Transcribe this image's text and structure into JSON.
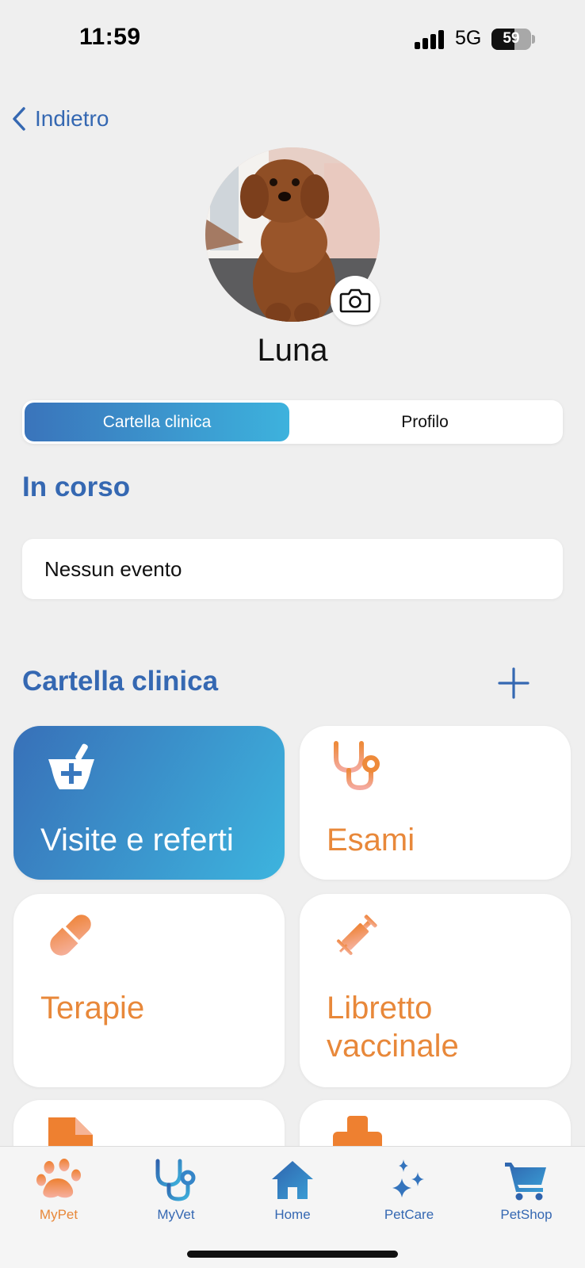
{
  "status_bar": {
    "time": "11:59",
    "network": "5G",
    "battery": "59"
  },
  "nav": {
    "back_label": "Indietro"
  },
  "pet": {
    "name": "Luna",
    "photo": "dog-photo"
  },
  "segmented": {
    "active": "Cartella clinica",
    "other": "Profilo"
  },
  "in_corso": {
    "title": "In corso",
    "empty_text": "Nessun evento"
  },
  "cartella": {
    "title": "Cartella clinica",
    "tiles": [
      {
        "label": "Visite e referti",
        "icon": "mortar-pestle-medical-icon",
        "active": true
      },
      {
        "label": "Esami",
        "icon": "stethoscope-icon",
        "active": false
      },
      {
        "label": "Terapie",
        "icon": "pill-icon",
        "active": false
      },
      {
        "label": "Libretto vaccinale",
        "icon": "syringe-icon",
        "active": false
      },
      {
        "label": "",
        "icon": "document-icon",
        "active": false
      },
      {
        "label": "",
        "icon": "medical-case-icon",
        "active": false
      }
    ]
  },
  "tabbar": {
    "items": [
      {
        "label": "MyPet",
        "icon": "paw-icon",
        "active": true
      },
      {
        "label": "MyVet",
        "icon": "stethoscope-icon",
        "active": false
      },
      {
        "label": "Home",
        "icon": "home-icon",
        "active": false
      },
      {
        "label": "PetCare",
        "icon": "sparkles-icon",
        "active": false
      },
      {
        "label": "PetShop",
        "icon": "cart-icon",
        "active": false
      }
    ]
  },
  "colors": {
    "blue": "#3568b2",
    "orange": "#e8883a",
    "gradient_start": "#3a74bb",
    "gradient_end": "#3db2dd",
    "background": "#efefef"
  }
}
